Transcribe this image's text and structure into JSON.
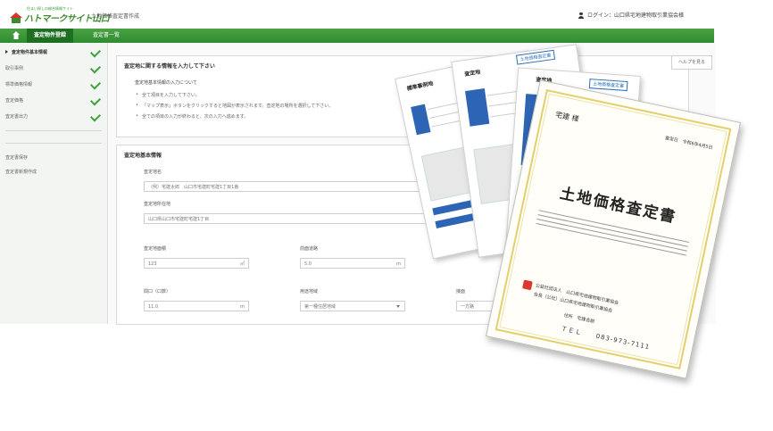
{
  "header": {
    "logo_tagline": "住まい探しの総合情報サイト",
    "brand": "ハトマークサイト山口",
    "app_title": "土地価格査定書作成",
    "user": "ログイン：山口県宅地建物取引業協会様"
  },
  "nav": {
    "tabs": [
      {
        "label": "査定物件登録"
      },
      {
        "label": "査定書一覧"
      }
    ]
  },
  "sidebar": {
    "items": [
      {
        "label": "査定物件基本情報",
        "checked": true
      },
      {
        "label": "取引事例",
        "checked": true
      },
      {
        "label": "標準価格情報",
        "checked": true
      },
      {
        "label": "査定価格",
        "checked": true
      },
      {
        "label": "査定書出力",
        "checked": true
      }
    ],
    "extra_items": [
      {
        "label": "査定書保存"
      },
      {
        "label": "査定書新規作成"
      }
    ]
  },
  "main": {
    "panel1": {
      "title": "査定地に関する情報を入力して下さい",
      "subtitle": "査定地基本情報の入力について",
      "bullets": [
        "全て項目を入力して下さい。",
        "「マップ表示」ボタンをクリックすると地図が表示されます。査定地の場所を選択して下さい。",
        "全ての項目の入力が終わると、次の入力へ進めます。"
      ]
    },
    "side_button": "ヘルプを見る",
    "panel2": {
      "title": "査定地基本情報",
      "fields": [
        {
          "label": "査定地名",
          "value": "（例）宅建太郎　山口市宅建町宅建1丁目1番"
        },
        {
          "label": "査定地所在地",
          "value": "山口県山口市宅建町宅建1丁目"
        },
        {
          "label": "査定地面積",
          "value": "123",
          "unit": "㎡"
        },
        {
          "label": "前面道路",
          "value": "5.0",
          "unit": "m"
        },
        {
          "label": "間口（口数）",
          "value": "11.0",
          "unit": "m"
        },
        {
          "label": "用途地域",
          "value": "第一種住居地域"
        },
        {
          "label": "接面",
          "value": "一方路"
        }
      ]
    }
  },
  "documents": {
    "doc1_title": "標準事例地",
    "doc2_title": "査定地",
    "doc2_tag": "土地価格査定書",
    "doc3_tag": "土地価格査定書",
    "certificate": {
      "addressee": "宅建 様",
      "number": "査定日　令和6年4月5日",
      "title": "土地価格査定書",
      "org_line1": "公益社団法人　山口県宅地建物取引業協会",
      "org_line2": "会長（公社）山口県宅地建物取引業協会",
      "address_label": "住所　宅建会館",
      "tel": "ＴＥＬ　　083-973-7111"
    }
  }
}
